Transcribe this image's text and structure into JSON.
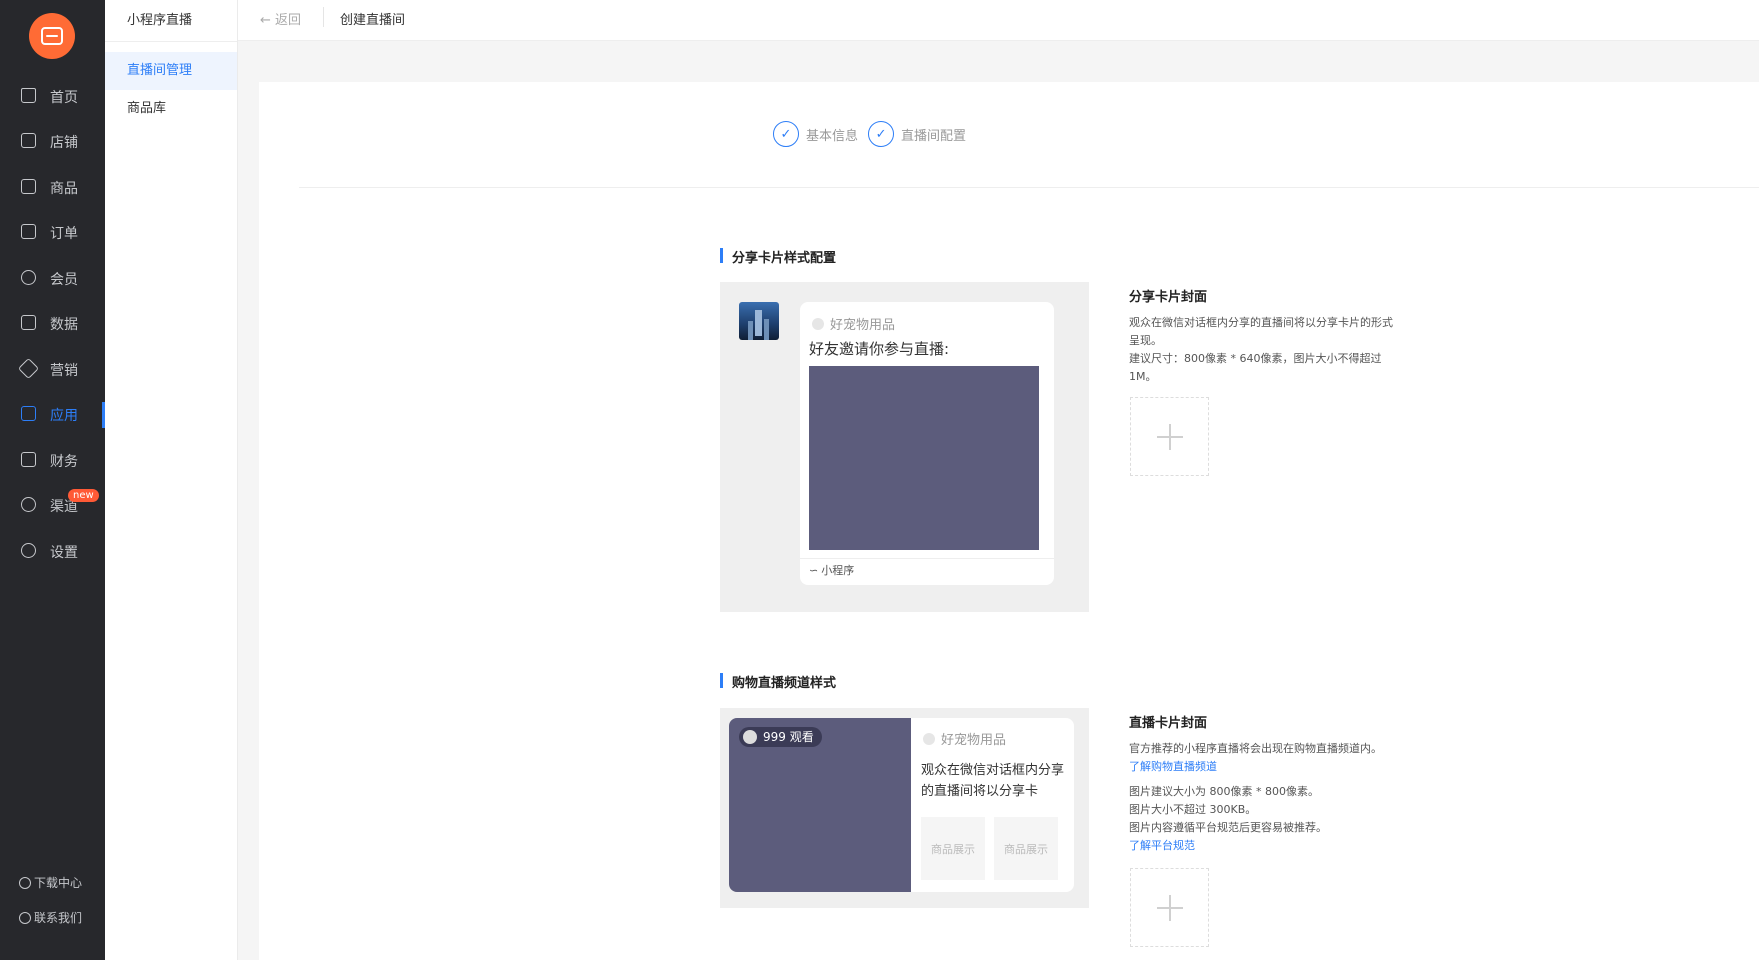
{
  "nav": {
    "items": [
      {
        "label": "首页",
        "icon": "home-icon"
      },
      {
        "label": "店铺",
        "icon": "store-icon"
      },
      {
        "label": "商品",
        "icon": "goods-icon"
      },
      {
        "label": "订单",
        "icon": "order-icon"
      },
      {
        "label": "会员",
        "icon": "user-icon"
      },
      {
        "label": "数据",
        "icon": "chart-icon"
      },
      {
        "label": "营销",
        "icon": "tag-icon"
      },
      {
        "label": "应用",
        "icon": "app-icon"
      },
      {
        "label": "财务",
        "icon": "finance-icon"
      },
      {
        "label": "渠道",
        "icon": "channel-icon",
        "badge": "new"
      },
      {
        "label": "设置",
        "icon": "gear-icon"
      }
    ],
    "active_index": 7,
    "footer": {
      "download": "下载中心",
      "contact": "联系我们"
    }
  },
  "subnav": {
    "title": "小程序直播",
    "items": [
      "直播间管理",
      "商品库"
    ]
  },
  "topbar": {
    "back": "返回",
    "breadcrumb": "创建直播间"
  },
  "steps": [
    {
      "label": "基本信息"
    },
    {
      "label": "直播间配置"
    }
  ],
  "share_card": {
    "section_title": "分享卡片样式配置",
    "shop_name": "好宠物用品",
    "invite_text": "好友邀请你参与直播:",
    "mini_label": "小程序",
    "desc_title": "分享卡片封面",
    "desc_lines": [
      "观众在微信对话框内分享的直播间将以分享卡片的形式",
      "呈现。",
      "建议尺寸：800像素 * 640像素，图片大小不得超过",
      "1M。"
    ]
  },
  "live_channel": {
    "section_title": "购物直播频道样式",
    "viewer_count": "999 观看",
    "shop_name": "好宠物用品",
    "live_text": "观众在微信对话框内分享的直播间将以分享卡",
    "goods_labels": [
      "商品展示",
      "商品展示"
    ],
    "desc_title": "直播卡片封面",
    "desc_line1": "官方推荐的小程序直播将会出现在购物直播频道内。",
    "link1": "了解购物直播频道",
    "desc_line2": "图片建议大小为 800像素 * 800像素。",
    "desc_line3": "图片大小不超过 300KB。",
    "desc_line4": "图片内容遵循平台规范后更容易被推荐。",
    "link2": "了解平台规范"
  },
  "colors": {
    "accent": "#2d7ef7",
    "nav_bg": "#27282c",
    "brand": "#ff6b35",
    "badge": "#ff5a36",
    "placeholder": "#5c5c7c"
  }
}
